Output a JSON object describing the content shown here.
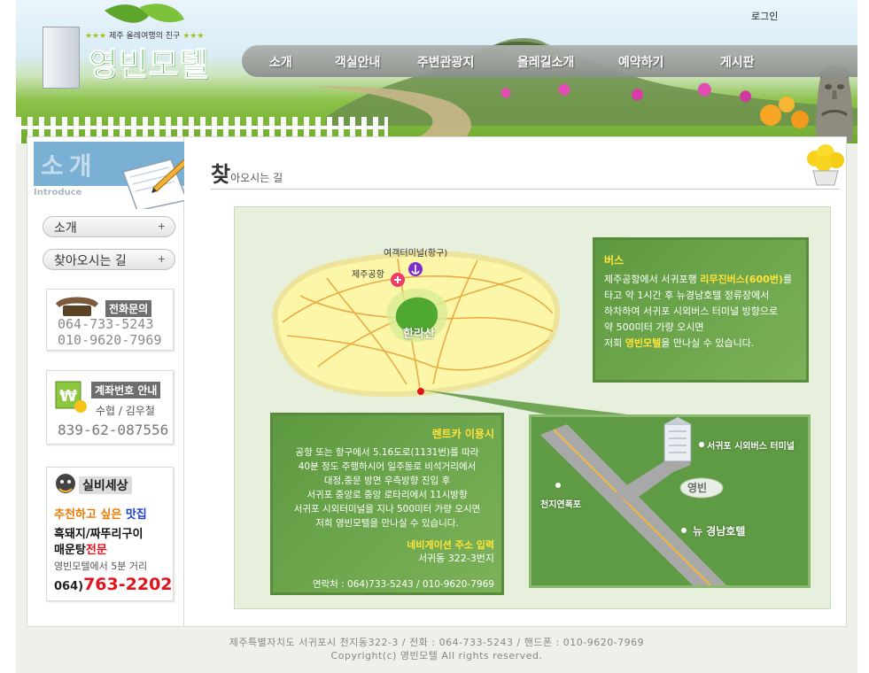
{
  "header": {
    "tagline": "제주 올레여행의 친구",
    "stars": "★★★",
    "logo_title": "영빈모텔",
    "login": "로그인",
    "nav": [
      "소개",
      "객실안내",
      "주변관광지",
      "올레길소개",
      "예약하기",
      "게시판"
    ]
  },
  "sidebar": {
    "heading_ko": "소개",
    "heading_en": "Introduce",
    "menu": [
      {
        "label": "소개",
        "plus": "+"
      },
      {
        "label": "찾아오시는 길",
        "plus": "+"
      }
    ],
    "phone": {
      "title": "전화문의",
      "numbers": [
        "064-733-5243",
        "010-9620-7969"
      ]
    },
    "account": {
      "title": "계좌번호 안내",
      "holder": "수협 / 김우철",
      "number": "839-62-087556"
    },
    "restaurant": {
      "title": "실비세상",
      "rec_part1": "추천하고 싶은 ",
      "rec_part2": "맛집",
      "menu_line": "흑돼지/짜뚜리구이",
      "special_part1": "매운탕",
      "special_part2": "전문",
      "distance": "영빈모텔에서 5분 거리",
      "phone_prefix": "064)",
      "phone_main": "763-2202"
    }
  },
  "main": {
    "title_big": "찾",
    "title_rest": "아오시는 길"
  },
  "map": {
    "labels": {
      "ferry_terminal": "여객터미널(항구)",
      "airport": "제주공항",
      "hallasan": "한라산"
    },
    "bus": {
      "title": "버스",
      "l1a": "제주공항에서 서귀포행 ",
      "l1b": "리무진버스(600번)",
      "l1c": "를",
      "l2": "타고 약 1시간 후 뉴경남호텔 정류장에서",
      "l3": "하차하여 서귀포 시외버스 터미널 방향으로",
      "l4": "약 500미터 가량 오시면",
      "l5a": "저희 ",
      "l5b": "영빈모텔",
      "l5c": "을 만나실 수 있습니다."
    },
    "rentcar": {
      "title": "렌트카 이용시",
      "lines": [
        "공항 또는 항구에서 5.16도로(1131번)를 따라",
        "40분 정도 주행하시어 일주동로 비석거리에서",
        "대정,중문 방면 우측방향 진입 후",
        "서귀포 중앙로 중앙 로타리에서 11시방향",
        "서귀포 시외터미널을 지나 500미터 가량 오시면",
        "저희 영빈모텔을 만나실 수 있습니다."
      ],
      "nav_title": "네비게이션 주소 입력",
      "nav_address": "서귀동 322-3번지",
      "contact": "연락처 : 064)733-5243 / 010-9620-7969"
    },
    "detail": {
      "bus_terminal": "서귀포 시외버스 터미널",
      "motel": "영빈",
      "waterfall": "천지연폭포",
      "hotel": "뉴 경남호텔"
    }
  },
  "footer": {
    "address": "제주특별자치도 서귀포시 천지동322-3 / 전화 : 064-733-5243 / 핸드폰 : 010-9620-7969",
    "copyright": "Copyright(c) 영빈모텔 All rights reserved."
  },
  "colors": {
    "brand_green": "#27a72e",
    "panel_green": "#5d9940",
    "highlight_yellow": "#ffe33a",
    "accent_red": "#e0141c"
  }
}
